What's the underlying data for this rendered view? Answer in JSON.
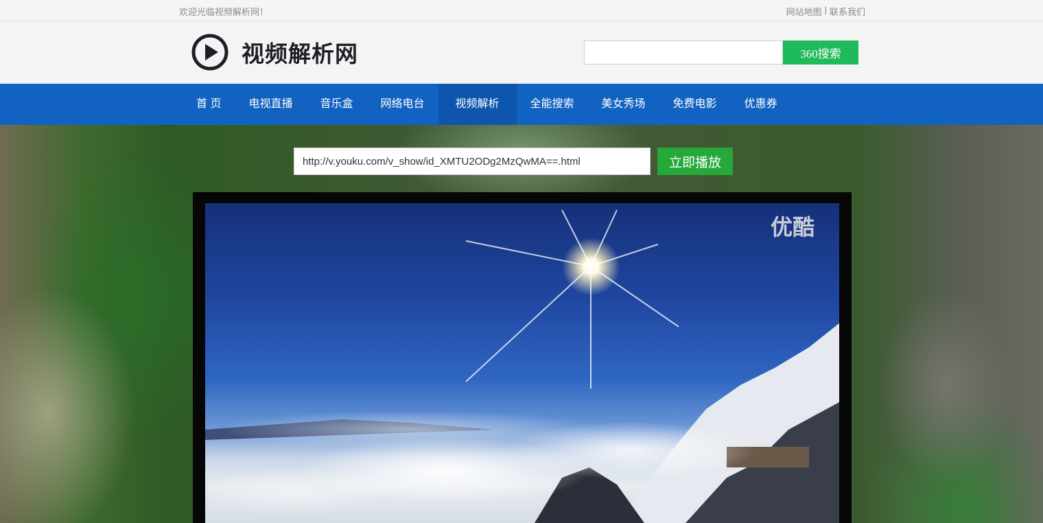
{
  "topbar": {
    "welcome": "欢迎光临视频解析网！",
    "links": [
      "网站地图",
      "|",
      "联系我们"
    ]
  },
  "header": {
    "logo_text": "视频解析网",
    "logo_icon": "play-circle-icon",
    "search_placeholder": "",
    "search_button": "360搜索"
  },
  "nav": {
    "items": [
      "首 页",
      "电视直播",
      "音乐盒",
      "网络电台",
      "视频解析",
      "全能搜索",
      "美女秀场",
      "免费电影",
      "优惠券"
    ],
    "active_index": 4
  },
  "player": {
    "url_value": "http://v.youku.com/v_show/id_XMTU2ODg2MzQwMA==.html",
    "play_button": "立即播放",
    "watermark": "优酷"
  },
  "colors": {
    "nav_bg": "#1262c1",
    "nav_active": "#0e55ad",
    "search_button": "#1fba5b",
    "play_button": "#26a83a"
  }
}
